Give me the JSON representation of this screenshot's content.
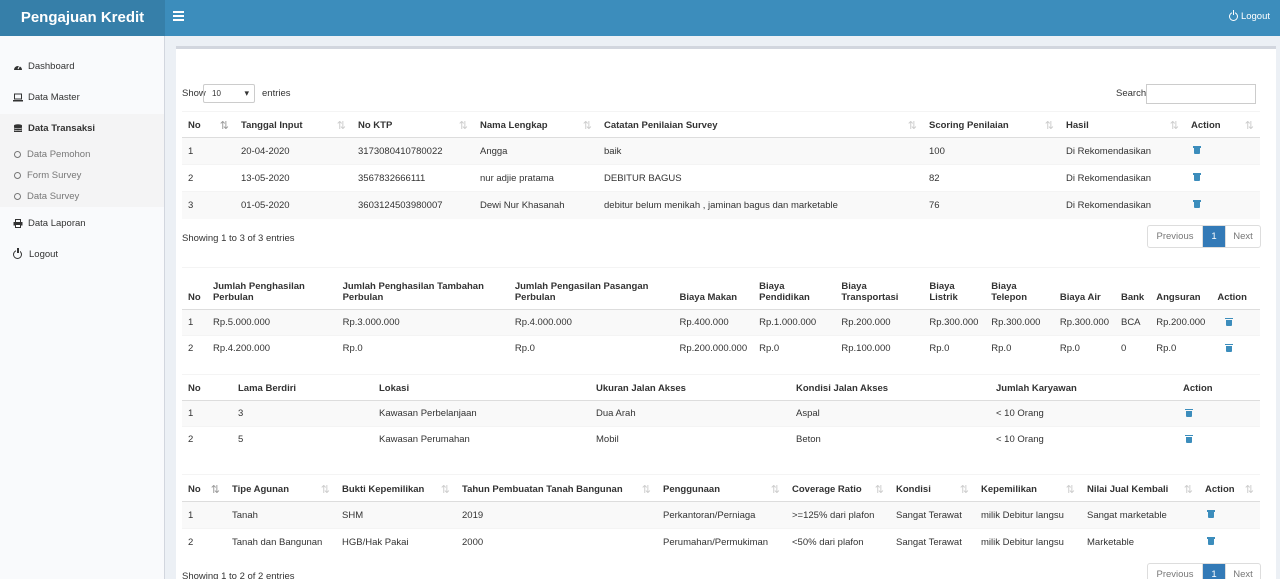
{
  "brand": "Pengajuan Kredit",
  "header": {
    "logout": "Logout"
  },
  "sidebar": {
    "items": [
      "Dashboard",
      "Data Master",
      "Data Transaksi",
      "Data Laporan",
      "Logout"
    ],
    "sub": [
      "Data Pemohon",
      "Form Survey",
      "Data Survey"
    ]
  },
  "controls": {
    "show": "Show",
    "entries_value": "10",
    "entries": "entries",
    "search": "Search:"
  },
  "table1": {
    "headers": [
      "No",
      "Tanggal Input",
      "No KTP",
      "Nama Lengkap",
      "Catatan Penilaian Survey",
      "Scoring Penilaian",
      "Hasil",
      "Action"
    ],
    "rows": [
      [
        "1",
        "20-04-2020",
        "3173080410780022",
        "Angga",
        "baik",
        "100",
        "Di Rekomendasikan"
      ],
      [
        "2",
        "13-05-2020",
        "3567832666111",
        "nur adjie pratama",
        "DEBITUR BAGUS",
        "82",
        "Di Rekomendasikan"
      ],
      [
        "3",
        "01-05-2020",
        "3603124503980007",
        "Dewi Nur Khasanah",
        "debitur belum menikah , jaminan bagus dan marketable",
        "76",
        "Di Rekomendasikan"
      ]
    ],
    "info": "Showing 1 to 3 of 3 entries"
  },
  "pager": {
    "prev": "Previous",
    "page": "1",
    "next": "Next"
  },
  "table2": {
    "headers": [
      "No",
      "Jumlah Penghasilan Perbulan",
      "Jumlah Penghasilan Tambahan Perbulan",
      "Jumlah Pengasilan Pasangan Perbulan",
      "Biaya Makan",
      "Biaya Pendidikan",
      "Biaya Transportasi",
      "Biaya Listrik",
      "Biaya Telepon",
      "Biaya Air",
      "Bank",
      "Angsuran",
      "Action"
    ],
    "rows": [
      [
        "1",
        "Rp.5.000.000",
        "Rp.3.000.000",
        "Rp.4.000.000",
        "Rp.400.000",
        "Rp.1.000.000",
        "Rp.200.000",
        "Rp.300.000",
        "Rp.300.000",
        "Rp.300.000",
        "BCA",
        "Rp.200.000"
      ],
      [
        "2",
        "Rp.4.200.000",
        "Rp.0",
        "Rp.0",
        "Rp.200.000.000",
        "Rp.0",
        "Rp.100.000",
        "Rp.0",
        "Rp.0",
        "Rp.0",
        "0",
        "Rp.0"
      ]
    ]
  },
  "table3": {
    "headers": [
      "No",
      "Lama Berdiri",
      "Lokasi",
      "Ukuran Jalan Akses",
      "Kondisi Jalan Akses",
      "Jumlah Karyawan",
      "Action"
    ],
    "rows": [
      [
        "1",
        "3",
        "Kawasan Perbelanjaan",
        "Dua Arah",
        "Aspal",
        "< 10 Orang"
      ],
      [
        "2",
        "5",
        "Kawasan Perumahan",
        "Mobil",
        "Beton",
        "< 10 Orang"
      ]
    ]
  },
  "table4": {
    "headers": [
      "No",
      "Tipe Agunan",
      "Bukti Kepemilikan",
      "Tahun Pembuatan Tanah Bangunan",
      "Penggunaan",
      "Coverage Ratio",
      "Kondisi",
      "Kepemilikan",
      "Nilai Jual Kembali",
      "Action"
    ],
    "rows": [
      [
        "1",
        "Tanah",
        "SHM",
        "2019",
        "Perkantoran/Perniaga",
        ">=125% dari plafon",
        "Sangat Terawat",
        "milik Debitur langsu",
        "Sangat marketable"
      ],
      [
        "2",
        "Tanah dan Bangunan",
        "HGB/Hak Pakai",
        "2000",
        "Perumahan/Permukiman",
        "<50% dari plafon",
        "Sangat Terawat",
        "milik Debitur langsu",
        "Marketable"
      ]
    ],
    "info": "Showing 1 to 2 of 2 entries"
  }
}
